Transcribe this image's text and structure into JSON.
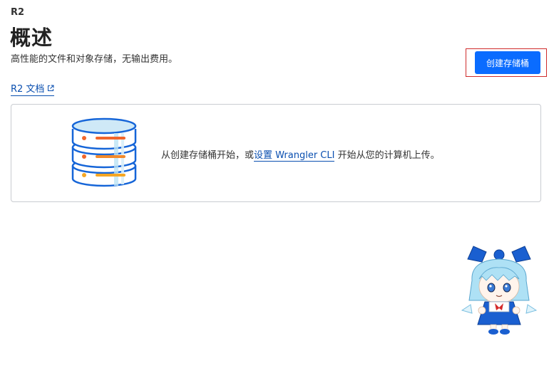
{
  "header": {
    "breadcrumb": "R2",
    "title": "概述",
    "subtitle": "高性能的文件和对象存储，无输出费用。",
    "docs_link": "R2 文档"
  },
  "actions": {
    "create_bucket_label": "创建存储桶"
  },
  "empty_state": {
    "text_before": "从创建存储桶开始，或",
    "link_text": "设置 Wrangler CLI",
    "text_after": " 开始从您的计算机上传。"
  },
  "colors": {
    "primary_button": "#0a6cff",
    "link": "#0a4fb0",
    "highlight_border": "#cf2b2b",
    "card_border": "#c9ccd1"
  },
  "icons": {
    "docs_link_icon": "external-link-icon",
    "empty_state_icon": "database-storage-icon",
    "mascot": "chibi-character-sticker"
  }
}
